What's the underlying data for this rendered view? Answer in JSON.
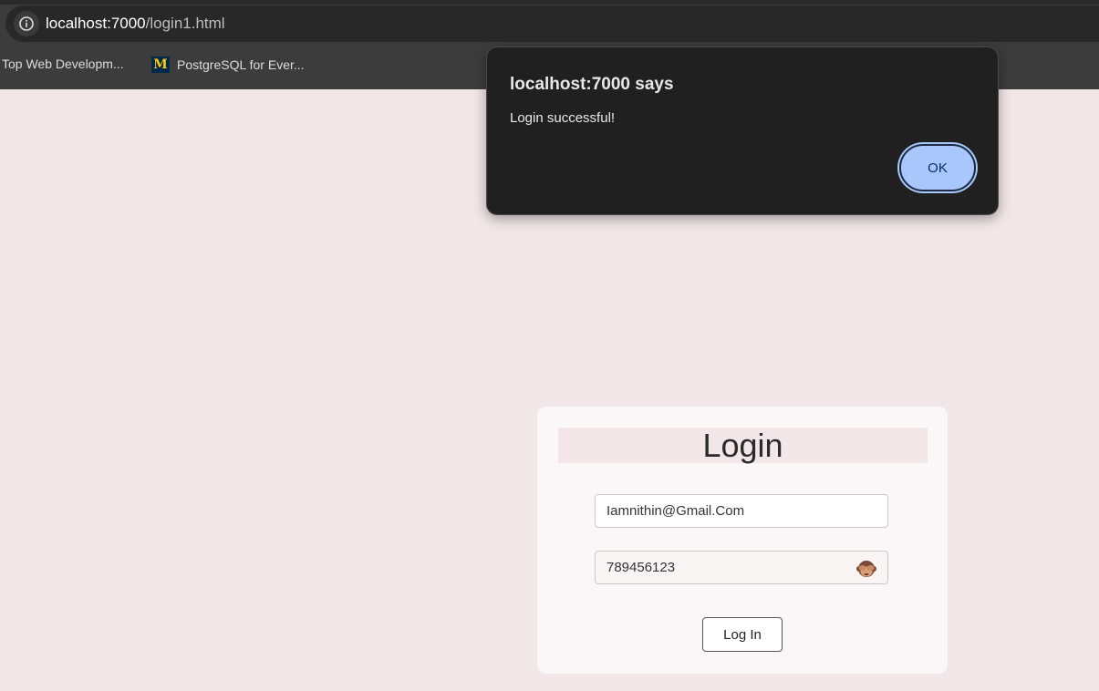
{
  "browser": {
    "url_host": "localhost:7000",
    "url_path": "/login1.html",
    "bookmarks": [
      {
        "label": "Top Web Developm...",
        "icon": "none"
      },
      {
        "label": "PostgreSQL for Ever...",
        "icon": "michigan-m-logo"
      }
    ]
  },
  "dialog": {
    "title": "localhost:7000 says",
    "message": "Login successful!",
    "ok_label": "OK"
  },
  "login": {
    "title": "Login",
    "email_value": "Iamnithin@Gmail.Com",
    "password_value": "789456123",
    "toggle_icon": "see-no-evil-monkey-icon",
    "submit_label": "Log In"
  },
  "colors": {
    "page_bg": "#f2e6e6",
    "dialog_bg": "#202020",
    "ok_button": "#a8c7fa",
    "card_bg": "#faf7f6"
  }
}
